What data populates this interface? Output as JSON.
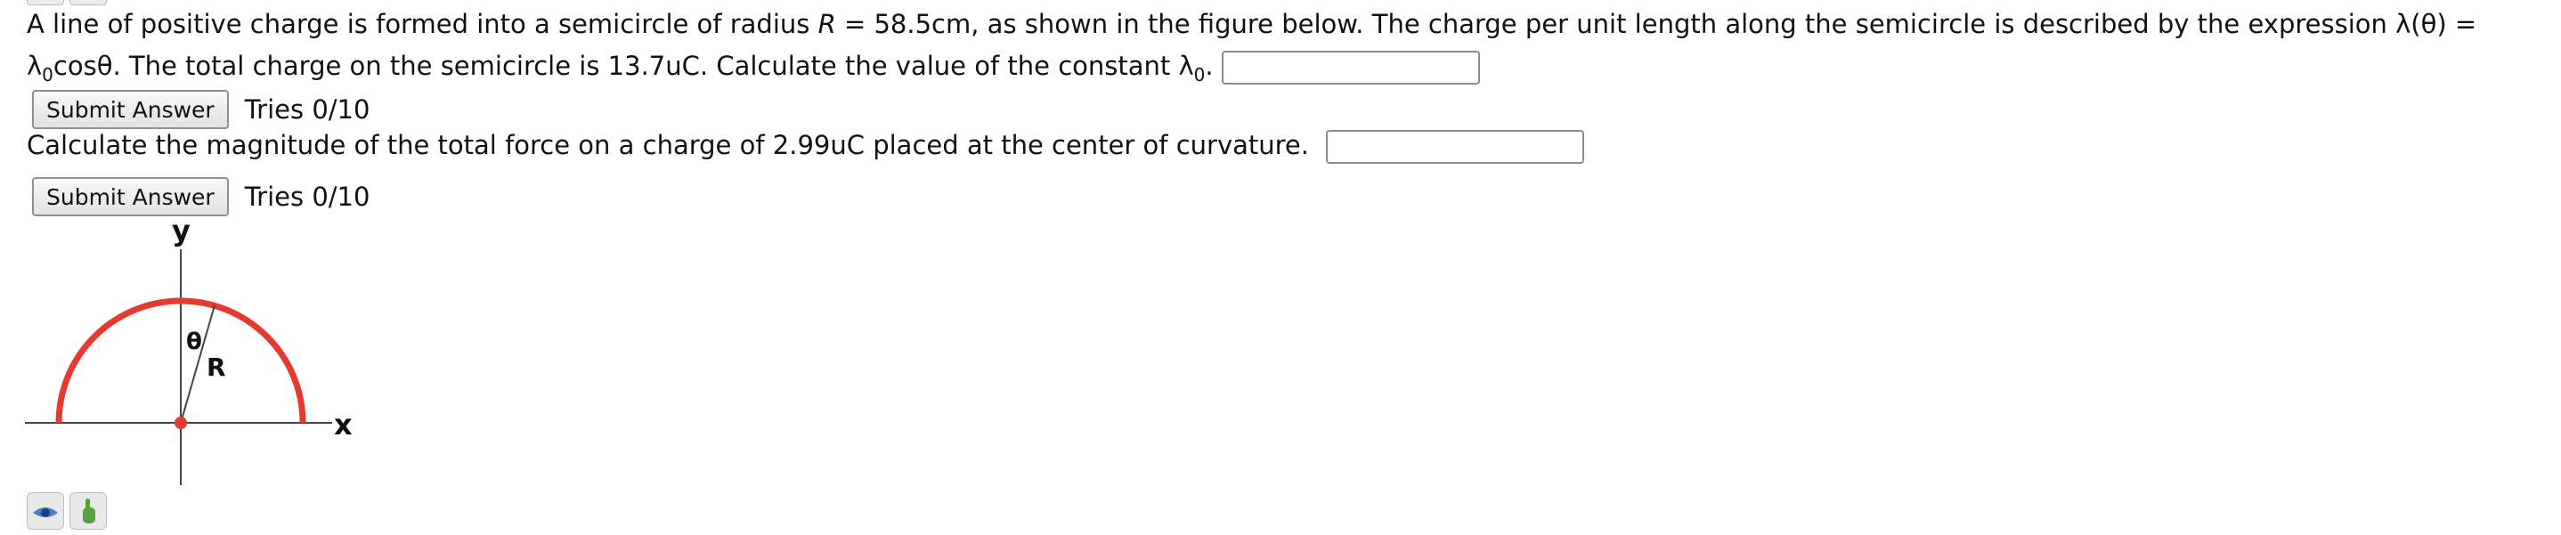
{
  "q1": {
    "part1": "A line of positive charge is formed into a semicircle of radius ",
    "radius_var": "R",
    "part2": " = 58.5cm, as shown in the figure below. The charge per unit length along the semicircle is described by the expression λ(θ) = λ",
    "sub1": "0",
    "part3": "cosθ. The total charge on the semicircle is 13.7uC. Calculate the value of the constant λ",
    "sub2": "0",
    "part4": "."
  },
  "q1_input": {
    "value": ""
  },
  "q1_submit": {
    "label": "Submit Answer",
    "tries": "Tries 0/10"
  },
  "q2": {
    "text": "Calculate the magnitude of the total force on a charge of 2.99uC placed at the center of curvature.",
    "input_value": ""
  },
  "q2_submit": {
    "label": "Submit Answer",
    "tries": "Tries 0/10"
  },
  "figure": {
    "y_label": "y",
    "x_label": "x",
    "theta_label": "θ",
    "r_label": "R"
  },
  "colors": {
    "arc": "#e53a2f",
    "axis": "#444444"
  },
  "bottom_icons": [
    "eye-icon",
    "hand-icon"
  ]
}
